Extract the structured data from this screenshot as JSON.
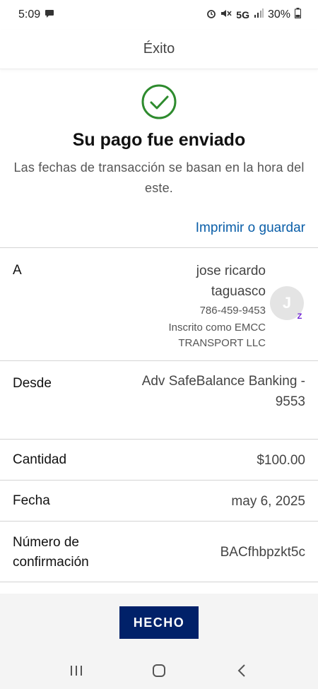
{
  "status_bar": {
    "time": "5:09",
    "network": "5G",
    "battery": "30%",
    "icons": [
      "message-icon",
      "alarm-icon",
      "mute-icon",
      "signal-icon",
      "battery-icon"
    ]
  },
  "header": {
    "title": "Éxito"
  },
  "success": {
    "icon": "check-circle-icon",
    "title": "Su pago fue enviado",
    "subtitle": "Las fechas de transacción se basan en la hora del este.",
    "print_link": "Imprimir o guardar"
  },
  "details": {
    "to": {
      "label": "A",
      "name": "jose ricardo taguasco",
      "phone": "786-459-9453",
      "enrolled": "Inscrito como EMCC TRANSPORT LLC",
      "avatar_initial": "J",
      "badge": "Z"
    },
    "from": {
      "label": "Desde",
      "value": "Adv SafeBalance Banking - 9553"
    },
    "amount": {
      "label": "Cantidad",
      "value": "$100.00"
    },
    "date": {
      "label": "Fecha",
      "value": "may 6, 2025"
    },
    "confirmation": {
      "label": "Número de confirmación",
      "value": "BACfhbpzkt5c"
    }
  },
  "footer": {
    "done_label": "HECHO"
  },
  "colors": {
    "accent": "#012169",
    "success": "#2e8b2e",
    "link": "#0a5ea8",
    "zelle": "#6d1ed4"
  },
  "nav": {
    "icons": [
      "recent-apps-icon",
      "home-icon",
      "back-icon"
    ]
  }
}
